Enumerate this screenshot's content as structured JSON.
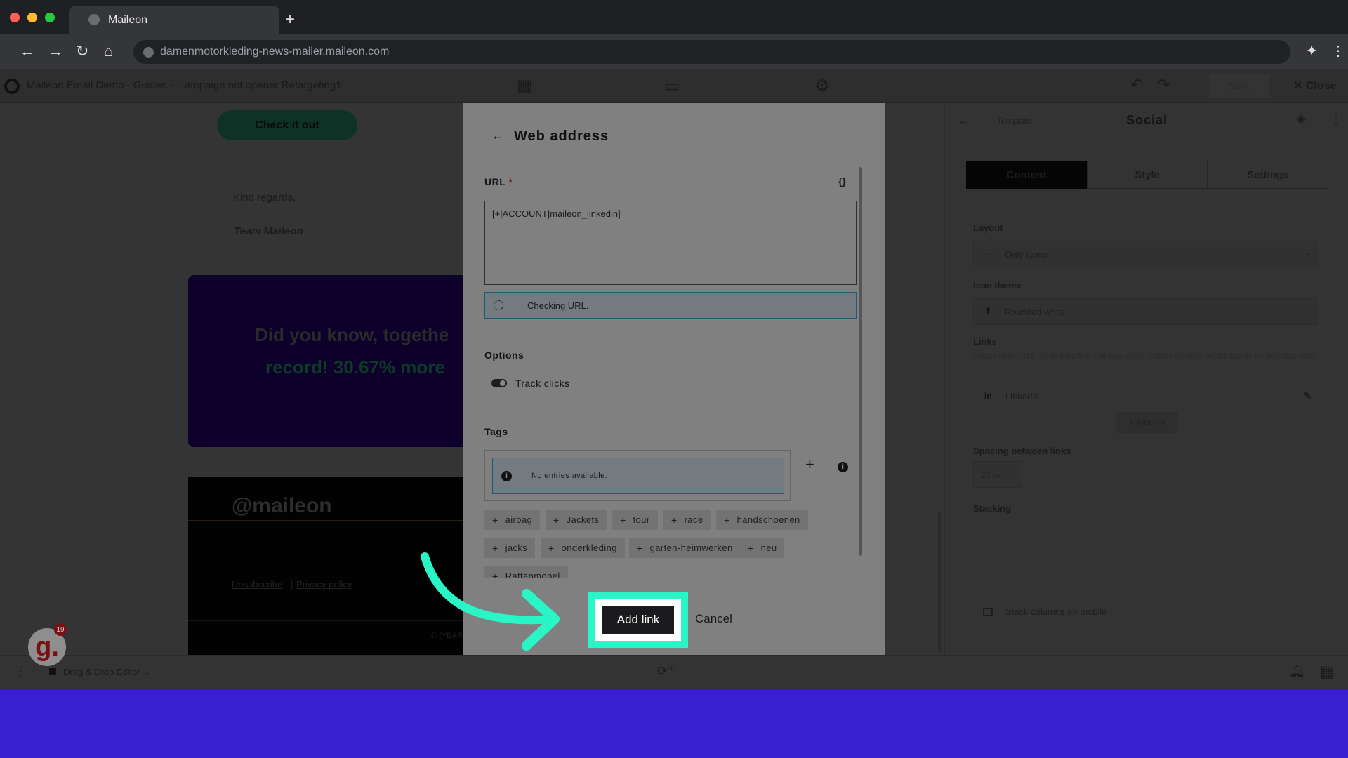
{
  "browser": {
    "tab_title": "Maileon",
    "url": "damenmotorkleding-news-mailer.maileon.com",
    "traffic_colors": [
      "#fe5f57",
      "#febc2e",
      "#28c840"
    ]
  },
  "app": {
    "breadcrumb": "Maileon Email Demo - Guides - ...ampaign not opener Retargeting1",
    "save": "Save",
    "close": "Close"
  },
  "email": {
    "cta": "Check it out",
    "regards": "Kind regards,",
    "team": "Team Maileon",
    "banner_line1": "Did you know, togethe",
    "banner_line2": "record! 30.67% more",
    "logo": "maileon",
    "unsubscribe": "Unsubscribe",
    "privacy": "Privacy policy",
    "copyright": "© {YEAR"
  },
  "right_panel": {
    "back": "Template",
    "title": "Social",
    "tabs": [
      "Content",
      "Style",
      "Settings"
    ],
    "layout_label": "Layout",
    "layout_value": "Only icons",
    "icon_theme_label": "Icon theme",
    "icon_theme_value": "Rounded white",
    "links_label": "Links",
    "links_note": "Please note that if not all links fit in one row, some Outlook versions would display the template wider.",
    "link_item": "Linkedin",
    "add_link": "Add link",
    "spacing_label": "Spacing between links",
    "spacing_value": "20 px",
    "stacking_label": "Stacking",
    "stack_mobile": "Stack columns on mobile"
  },
  "status_bar": {
    "editor": "Drag & Drop Editor",
    "off": "off"
  },
  "badge": {
    "count": "19",
    "letter": "g."
  },
  "modal": {
    "title": "Web address",
    "url_label": "URL",
    "required": "*",
    "url_value": "[+|ACCOUNT|maileon_linkedin]",
    "checking": "Checking URL.",
    "options_label": "Options",
    "track_clicks": "Track clicks",
    "track_clicks_on": true,
    "tags_label": "Tags",
    "no_entries": "No entries available.",
    "tags": [
      "airbag",
      "Jackets",
      "tour",
      "race",
      "handschoenen",
      "jacks",
      "onderkleding",
      "garten-heimwerken",
      "neu",
      "Rattanmöbel"
    ],
    "add_link": "Add link",
    "cancel": "Cancel"
  },
  "highlight_color": "#2af5c6"
}
